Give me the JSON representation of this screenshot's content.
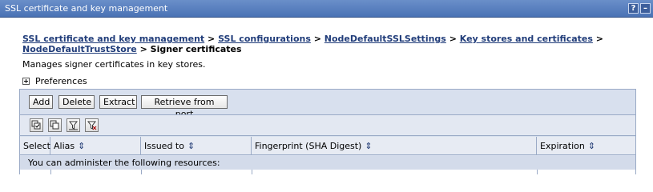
{
  "window": {
    "title": "SSL certificate and key management",
    "help_label": "?",
    "minimize_label": "–"
  },
  "breadcrumb": {
    "items": [
      "SSL certificate and key management",
      "SSL configurations",
      "NodeDefaultSSLSettings",
      "Key stores and certificates",
      "NodeDefaultTrustStore"
    ],
    "current": "Signer certificates",
    "separator": ">"
  },
  "description": "Manages signer certificates in key stores.",
  "preferences": {
    "label": "Preferences"
  },
  "toolbar": {
    "add": "Add",
    "delete": "Delete",
    "extract": "Extract",
    "retrieve": "Retrieve from port"
  },
  "icons": [
    "select-all-icon",
    "deselect-all-icon",
    "show-filter-icon",
    "clear-filter-icon"
  ],
  "table": {
    "columns": {
      "select": "Select",
      "alias": "Alias",
      "issued_to": "Issued to",
      "fingerprint": "Fingerprint (SHA Digest)",
      "expiration": "Expiration"
    },
    "sort_glyph": "⇕",
    "resources_note": "You can administer the following resources:"
  },
  "colors": {
    "title_bar": "#4a72b5",
    "link": "#213d7a",
    "panel": "#d8e0ee"
  }
}
